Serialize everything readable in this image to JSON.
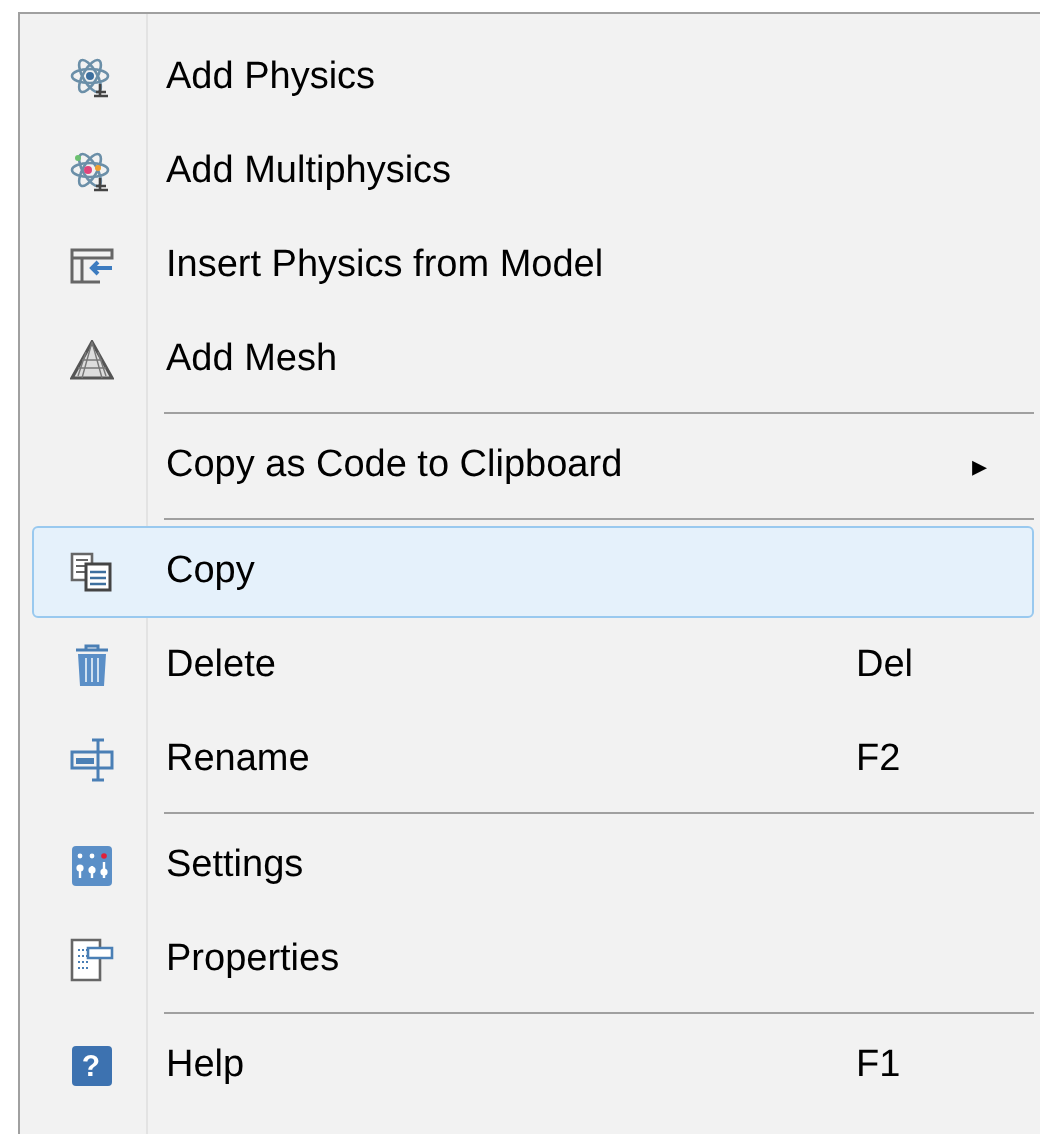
{
  "menu": {
    "items": [
      {
        "kind": "item",
        "label": "Add Physics",
        "selected": false
      },
      {
        "kind": "item",
        "label": "Add Multiphysics",
        "selected": false
      },
      {
        "kind": "item",
        "label": "Insert Physics from Model",
        "selected": false
      },
      {
        "kind": "item",
        "label": "Add Mesh",
        "selected": false
      },
      {
        "kind": "separator"
      },
      {
        "kind": "item",
        "label": "Copy as Code to Clipboard",
        "submenu": "▸",
        "selected": false
      },
      {
        "kind": "separator"
      },
      {
        "kind": "item",
        "label": "Copy",
        "selected": true
      },
      {
        "kind": "item",
        "label": "Delete",
        "shortcut": "Del",
        "selected": false
      },
      {
        "kind": "item",
        "label": "Rename",
        "shortcut": "F2",
        "selected": false
      },
      {
        "kind": "separator"
      },
      {
        "kind": "item",
        "label": "Settings",
        "selected": false
      },
      {
        "kind": "item",
        "label": "Properties",
        "selected": false
      },
      {
        "kind": "separator"
      },
      {
        "kind": "item",
        "icon_text": "?",
        "label": "Help",
        "shortcut": "F1",
        "selected": false
      }
    ]
  }
}
